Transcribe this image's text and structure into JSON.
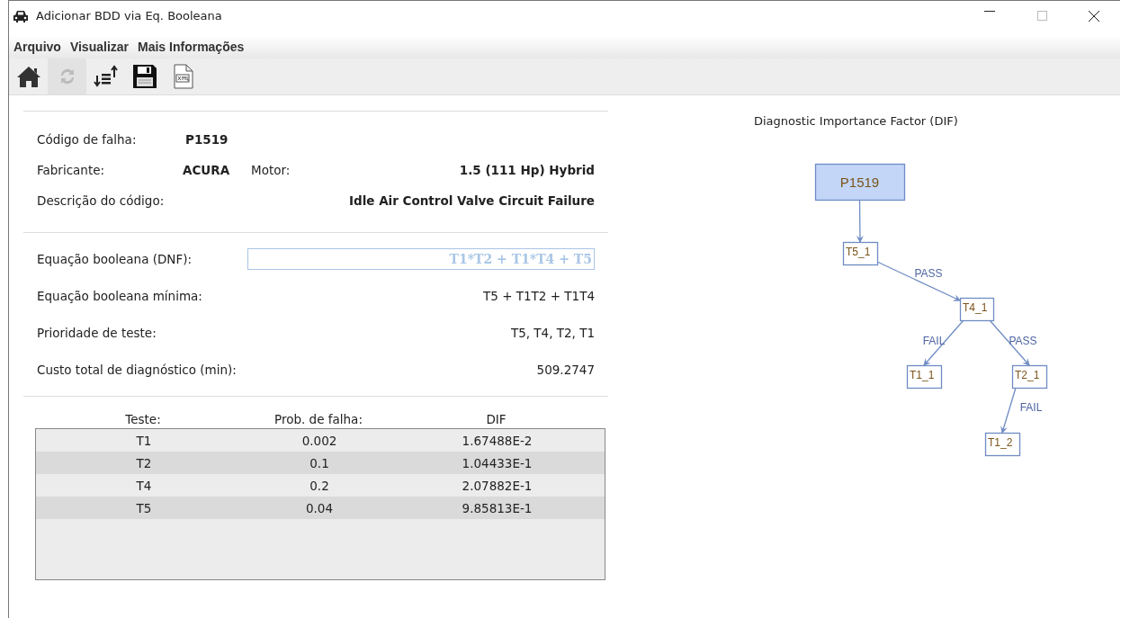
{
  "window": {
    "title": "Adicionar BDD via Eq. Booleana"
  },
  "menu": [
    "Arquivo",
    "Visualizar",
    "Mais Informações"
  ],
  "toolbar": [
    {
      "kind": "home",
      "disabled": false
    },
    {
      "kind": "refresh",
      "disabled": true
    },
    {
      "kind": "sort",
      "disabled": false
    },
    {
      "kind": "save",
      "disabled": false
    },
    {
      "kind": "xml",
      "disabled": false
    }
  ],
  "info": {
    "code_label": "Código de falha:",
    "code": "P1519",
    "maker_label": "Fabricante:",
    "maker": "ACURA",
    "engine_label": "Motor:",
    "engine": "1.5 (111 Hp) Hybrid",
    "desc_label": "Descrição do código:",
    "desc": "Idle Air Control Valve Circuit Failure"
  },
  "equation": {
    "label": "Equação booleana (DNF):",
    "value": "T1*T2 + T1*T4 + T5",
    "disabled": true
  },
  "results": [
    {
      "label": "Equação booleana mínima:",
      "value": "T5 + T1T2 + T1T4"
    },
    {
      "label": "Prioridade de teste:",
      "value": "T5, T4, T2, T1"
    },
    {
      "label": "Custo total de diagnóstico (min):",
      "value": "509.2747"
    }
  ],
  "table": {
    "columns": [
      "Teste:",
      "Prob. de falha:",
      "DIF"
    ],
    "rows": [
      [
        "T1",
        "0.002",
        "1.67488E-2"
      ],
      [
        "T2",
        "0.1",
        "1.04433E-1"
      ],
      [
        "T4",
        "0.2",
        "2.07882E-1"
      ],
      [
        "T5",
        "0.04",
        "9.85813E-1"
      ]
    ]
  },
  "diagram": {
    "title": "Diagnostic Importance Factor (DIF)",
    "root": {
      "label": "P1519",
      "children": [
        {
          "label": "T5_1",
          "children": [
            {
              "edge": "PASS",
              "label": "T4_1",
              "children": [
                {
                  "edge": "FAIL",
                  "label": "T1_1"
                },
                {
                  "edge": "PASS",
                  "label": "T2_1",
                  "children": [
                    {
                      "edge": "FAIL",
                      "label": "T1_2"
                    }
                  ]
                }
              ]
            }
          ]
        }
      ]
    }
  }
}
